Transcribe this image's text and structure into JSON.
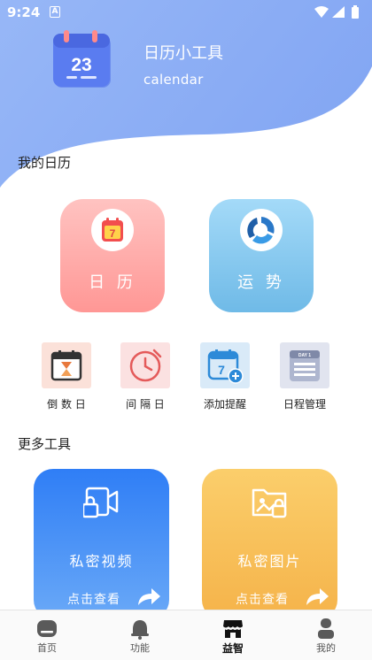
{
  "status_bar": {
    "time": "9:24",
    "notification_letter": "A",
    "icons": [
      "wifi-icon",
      "signal-icon",
      "battery-icon"
    ]
  },
  "header": {
    "title": "日历小工具",
    "subtitle": "calendar",
    "logo_day": "23",
    "accent_color": "#8fb0f5"
  },
  "my_calendar": {
    "title": "我的日历",
    "cards": [
      {
        "label": "日 历",
        "icon": "calendar-icon",
        "badge": "7",
        "color": "#ffa9a7"
      },
      {
        "label": "运 势",
        "icon": "fortune-icon",
        "color": "#86c7ee"
      }
    ],
    "tools": [
      {
        "label": "倒 数 日",
        "icon": "hourglass-calendar-icon"
      },
      {
        "label": "间 隔 日",
        "icon": "clock-icon"
      },
      {
        "label": "添加提醒",
        "icon": "add-reminder-icon",
        "badge": "7"
      },
      {
        "label": "日程管理",
        "icon": "schedule-icon",
        "badge": "DAY 1"
      }
    ]
  },
  "more_tools": {
    "title": "更多工具",
    "cards": [
      {
        "title": "私密视频",
        "action": "点击查看",
        "icon": "video-lock-icon",
        "color": "#3b85f6"
      },
      {
        "title": "私密图片",
        "action": "点击查看",
        "icon": "image-lock-icon",
        "color": "#f8c45d"
      }
    ]
  },
  "bottom_nav": [
    {
      "label": "首页",
      "icon": "home-icon",
      "active": false
    },
    {
      "label": "功能",
      "icon": "bell-icon",
      "active": false
    },
    {
      "label": "益智",
      "icon": "store-icon",
      "active": true
    },
    {
      "label": "我的",
      "icon": "user-icon",
      "active": false
    }
  ]
}
